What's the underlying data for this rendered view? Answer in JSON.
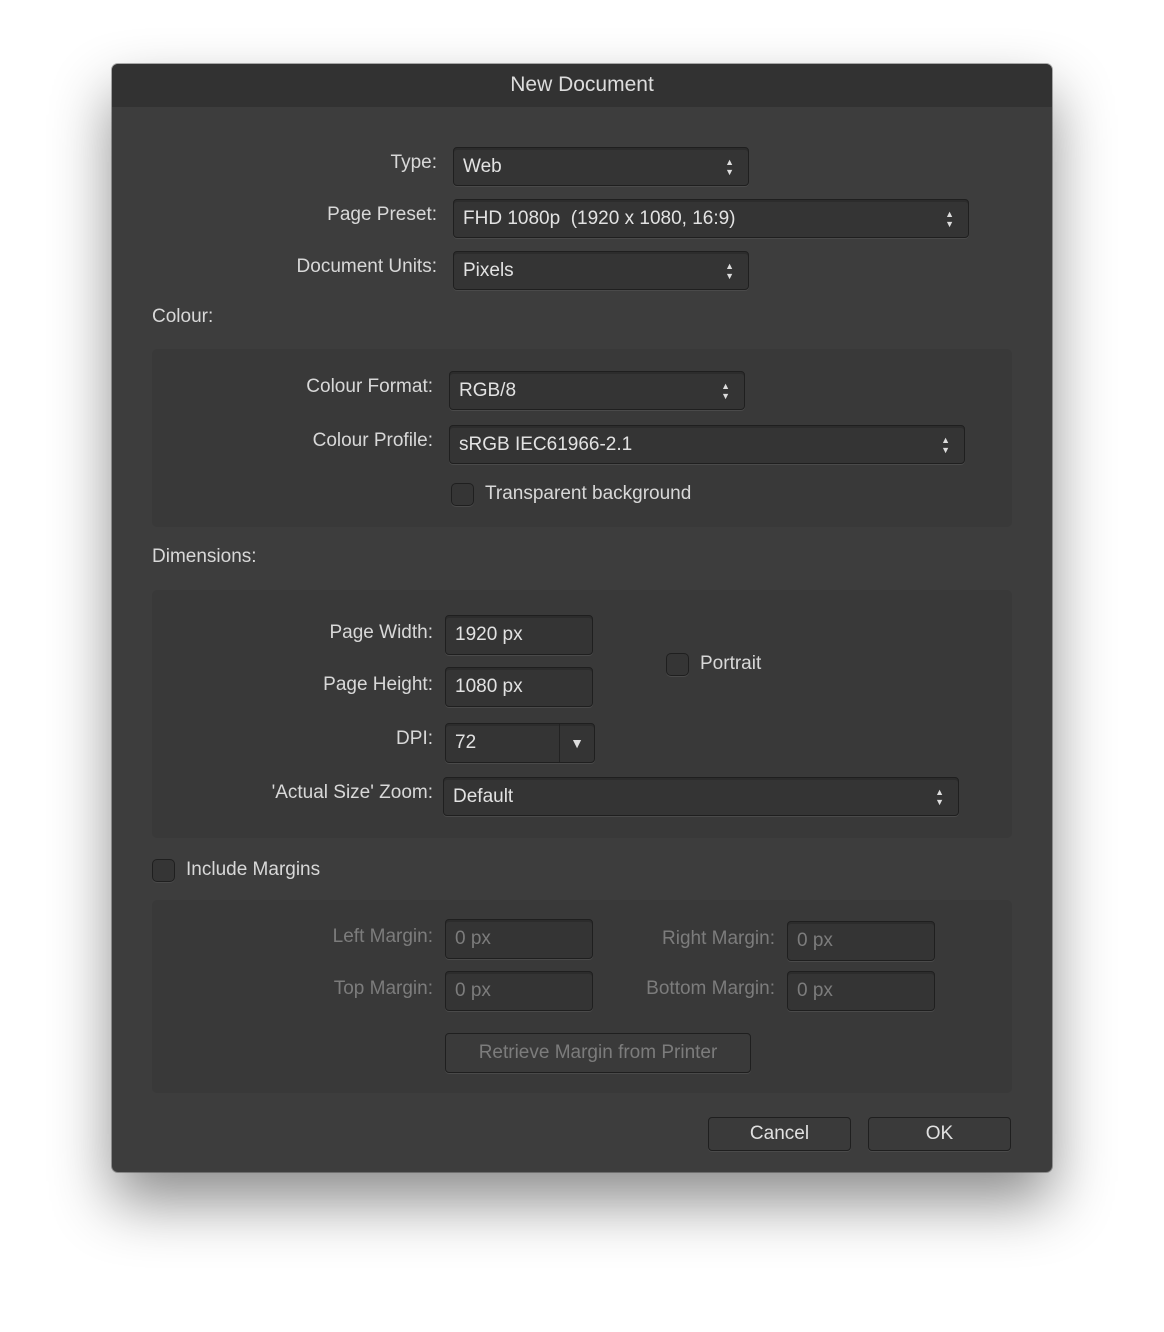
{
  "title": "New Document",
  "type": {
    "label": "Type:",
    "value": "Web"
  },
  "page_preset": {
    "label": "Page Preset:",
    "value": "FHD 1080p  (1920 x 1080, 16:9)"
  },
  "units": {
    "label": "Document Units:",
    "value": "Pixels"
  },
  "colour": {
    "heading": "Colour:",
    "format_label": "Colour Format:",
    "format_value": "RGB/8",
    "profile_label": "Colour Profile:",
    "profile_value": "sRGB IEC61966-2.1",
    "transparent_label": "Transparent background",
    "transparent_checked": false
  },
  "dimensions": {
    "heading": "Dimensions:",
    "width_label": "Page Width:",
    "width_value": "1920 px",
    "height_label": "Page Height:",
    "height_value": "1080 px",
    "dpi_label": "DPI:",
    "dpi_value": "72",
    "zoom_label": "'Actual Size' Zoom:",
    "zoom_value": "Default",
    "portrait_label": "Portrait",
    "portrait_checked": false
  },
  "margins": {
    "include_label": "Include Margins",
    "include_checked": false,
    "left_label": "Left Margin:",
    "left_value": "0 px",
    "right_label": "Right Margin:",
    "right_value": "0 px",
    "top_label": "Top Margin:",
    "top_value": "0 px",
    "bottom_label": "Bottom Margin:",
    "bottom_value": "0 px",
    "retrieve_label": "Retrieve Margin from Printer"
  },
  "buttons": {
    "cancel": "Cancel",
    "ok": "OK"
  }
}
